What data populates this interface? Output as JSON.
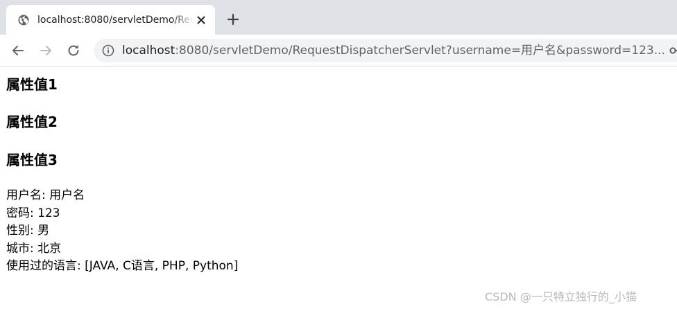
{
  "browser": {
    "tab": {
      "title": "localhost:8080/servletDemo/RequestDispatcherServlet",
      "favicon": "globe-icon",
      "close_icon": "close-icon"
    },
    "new_tab_icon": "plus-icon",
    "nav": {
      "back_icon": "arrow-left-icon",
      "forward_icon": "arrow-right-icon",
      "reload_icon": "reload-icon"
    },
    "address": {
      "info_icon": "info-icon",
      "host": "localhost",
      "rest": ":8080/servletDemo/RequestDispatcherServlet?username=用户名&password=123...",
      "key_icon": "key-icon"
    },
    "colors": {
      "tabstrip_bg": "#dee1e6",
      "omnibox_bg": "#f1f3f4"
    }
  },
  "page": {
    "headings": [
      "属性值1",
      "属性值2",
      "属性值3"
    ],
    "lines": [
      "用户名: 用户名",
      "密码: 123",
      "性别: 男",
      "城市: 北京",
      "使用过的语言: [JAVA, C语言, PHP, Python]"
    ]
  },
  "watermark": "CSDN @一只特立独行的_小猫"
}
